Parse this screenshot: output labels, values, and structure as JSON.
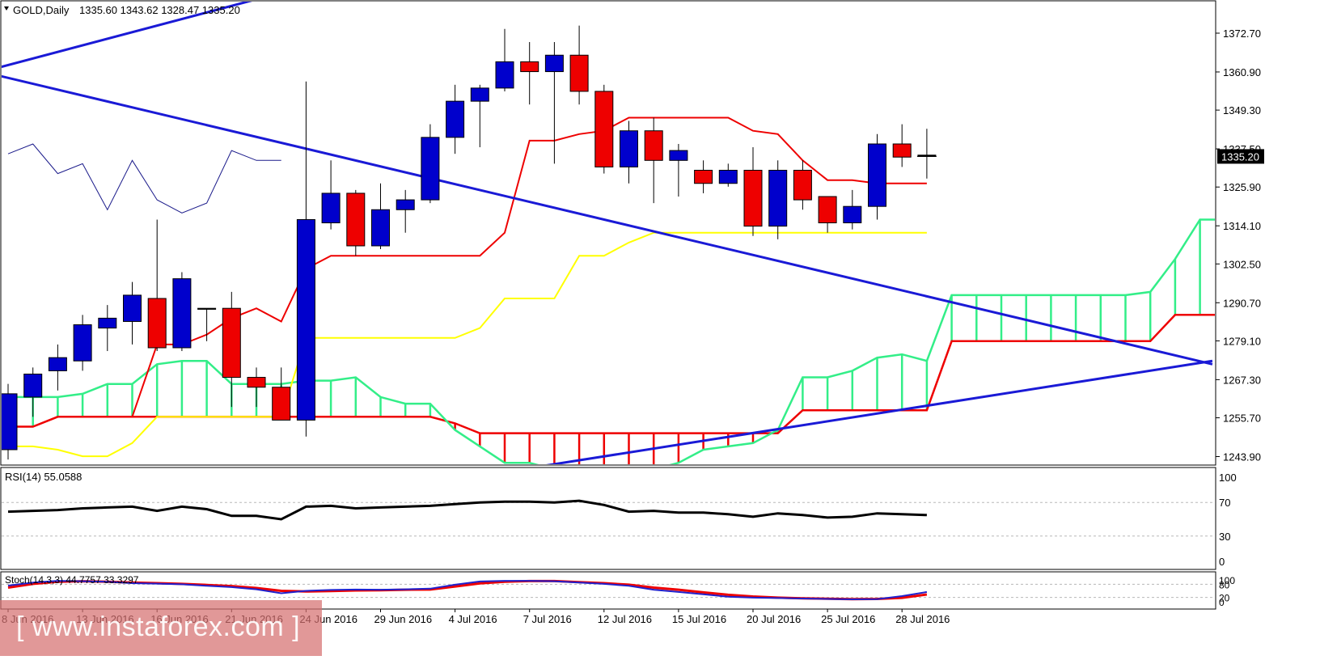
{
  "header": {
    "symbol": "GOLD,Daily",
    "ohlc": "1335.60 1343.62 1328.47 1335.20"
  },
  "watermark": {
    "text": "[ www.instaforex.com ]"
  },
  "colors": {
    "bull_candle": "#0000cc",
    "bear_candle": "#ee0000",
    "tenkan": "#ee0000",
    "kijun": "#ffff00",
    "senkou_a": "#33ee88",
    "senkou_b": "#ee0000",
    "trendline": "#1a1ad6",
    "chikou": "#1a1a8a",
    "rsi": "#000000",
    "stoch_main": "#2020cc",
    "stoch_signal": "#ee0000"
  },
  "chart_data": [
    {
      "type": "candlestick",
      "panel": "main",
      "title": "GOLD,Daily",
      "ylim": [
        1236,
        1385
      ],
      "y_ticks": [
        "1372.70",
        "1360.90",
        "1349.30",
        "1337.50",
        "1325.90",
        "1314.10",
        "1302.50",
        "1290.70",
        "1279.10",
        "1267.30",
        "1255.70",
        "1243.90"
      ],
      "current_price": "1335.20",
      "x_labels": [
        {
          "i": 0,
          "label": "8 Jun 2016"
        },
        {
          "i": 3,
          "label": "13 Jun 2016"
        },
        {
          "i": 6,
          "label": "16 Jun 2016"
        },
        {
          "i": 9,
          "label": "21 Jun 2016"
        },
        {
          "i": 12,
          "label": "24 Jun 2016"
        },
        {
          "i": 15,
          "label": "29 Jun 2016"
        },
        {
          "i": 18,
          "label": "4 Jul 2016"
        },
        {
          "i": 21,
          "label": "7 Jul 2016"
        },
        {
          "i": 24,
          "label": "12 Jul 2016"
        },
        {
          "i": 27,
          "label": "15 Jul 2016"
        },
        {
          "i": 30,
          "label": "20 Jul 2016"
        },
        {
          "i": 33,
          "label": "25 Jul 2016"
        },
        {
          "i": 36,
          "label": "28 Jul 2016"
        }
      ],
      "candles": [
        {
          "o": 1246,
          "h": 1266,
          "l": 1243,
          "c": 1263
        },
        {
          "o": 1262,
          "h": 1271,
          "l": 1256,
          "c": 1269
        },
        {
          "o": 1270,
          "h": 1278,
          "l": 1264,
          "c": 1274
        },
        {
          "o": 1273,
          "h": 1287,
          "l": 1270,
          "c": 1284
        },
        {
          "o": 1283,
          "h": 1290,
          "l": 1276,
          "c": 1286
        },
        {
          "o": 1285,
          "h": 1297,
          "l": 1278,
          "c": 1293
        },
        {
          "o": 1292,
          "h": 1316,
          "l": 1276,
          "c": 1277
        },
        {
          "o": 1277,
          "h": 1300,
          "l": 1276,
          "c": 1298
        },
        {
          "o": 1289,
          "h": 1289,
          "l": 1279,
          "c": 1289
        },
        {
          "o": 1289,
          "h": 1294,
          "l": 1259,
          "c": 1268
        },
        {
          "o": 1268,
          "h": 1271,
          "l": 1259,
          "c": 1265
        },
        {
          "o": 1265,
          "h": 1271,
          "l": 1255,
          "c": 1255
        },
        {
          "o": 1255,
          "h": 1358,
          "l": 1250,
          "c": 1316
        },
        {
          "o": 1315,
          "h": 1334,
          "l": 1313,
          "c": 1324
        },
        {
          "o": 1324,
          "h": 1325,
          "l": 1305,
          "c": 1308
        },
        {
          "o": 1308,
          "h": 1327,
          "l": 1307,
          "c": 1319
        },
        {
          "o": 1319,
          "h": 1325,
          "l": 1312,
          "c": 1322
        },
        {
          "o": 1322,
          "h": 1345,
          "l": 1321,
          "c": 1341
        },
        {
          "o": 1341,
          "h": 1357,
          "l": 1336,
          "c": 1352
        },
        {
          "o": 1352,
          "h": 1357,
          "l": 1338,
          "c": 1356
        },
        {
          "o": 1356,
          "h": 1374,
          "l": 1355,
          "c": 1364
        },
        {
          "o": 1364,
          "h": 1370,
          "l": 1351,
          "c": 1361
        },
        {
          "o": 1361,
          "h": 1370,
          "l": 1333,
          "c": 1366
        },
        {
          "o": 1366,
          "h": 1375,
          "l": 1351,
          "c": 1355
        },
        {
          "o": 1355,
          "h": 1357,
          "l": 1330,
          "c": 1332
        },
        {
          "o": 1332,
          "h": 1346,
          "l": 1327,
          "c": 1343
        },
        {
          "o": 1343,
          "h": 1347,
          "l": 1321,
          "c": 1334
        },
        {
          "o": 1334,
          "h": 1339,
          "l": 1323,
          "c": 1337
        },
        {
          "o": 1331,
          "h": 1334,
          "l": 1324,
          "c": 1327
        },
        {
          "o": 1327,
          "h": 1333,
          "l": 1326,
          "c": 1331
        },
        {
          "o": 1331,
          "h": 1338,
          "l": 1311,
          "c": 1314
        },
        {
          "o": 1314,
          "h": 1334,
          "l": 1310,
          "c": 1331
        },
        {
          "o": 1331,
          "h": 1334,
          "l": 1319,
          "c": 1322
        },
        {
          "o": 1323,
          "h": 1323,
          "l": 1312,
          "c": 1315
        },
        {
          "o": 1315,
          "h": 1325,
          "l": 1313,
          "c": 1320
        },
        {
          "o": 1320,
          "h": 1342,
          "l": 1316,
          "c": 1339
        },
        {
          "o": 1339,
          "h": 1345,
          "l": 1332,
          "c": 1335
        },
        {
          "o": 1335.6,
          "h": 1343.62,
          "l": 1328.47,
          "c": 1335.2
        }
      ],
      "tenkan": [
        1253,
        1253,
        1256,
        1256,
        1256,
        1256,
        1278,
        1278,
        1281,
        1286,
        1289,
        1285,
        1301,
        1305,
        1305,
        1305,
        1305,
        1305,
        1305,
        1305,
        1312,
        1340,
        1340,
        1342,
        1343,
        1347,
        1347,
        1347,
        1347,
        1347,
        1343,
        1342,
        1334,
        1328,
        1328,
        1327,
        1327,
        1327
      ],
      "kijun": [
        1247,
        1247,
        1246,
        1244,
        1244,
        1248,
        1256,
        1256,
        1256,
        1256,
        1256,
        1256,
        1280,
        1280,
        1280,
        1280,
        1280,
        1280,
        1280,
        1283,
        1292,
        1292,
        1292,
        1305,
        1305,
        1309,
        1312,
        1312,
        1312,
        1312,
        1312,
        1312,
        1312,
        1312,
        1312,
        1312,
        1312,
        1312
      ],
      "senkou_a": [
        1262,
        1262,
        1262,
        1263,
        1266,
        1266,
        1272,
        1273,
        1273,
        1266,
        1266,
        1266,
        1267,
        1267,
        1268,
        1262,
        1260,
        1260,
        1252,
        1247,
        1242,
        1242,
        1240,
        1240,
        1240,
        1240,
        1240,
        1242,
        1246,
        1247,
        1248,
        1252,
        1268,
        1268,
        1270,
        1274,
        1275,
        1273,
        1293,
        1293,
        1293,
        1293,
        1293,
        1293,
        1293,
        1293,
        1294,
        1304,
        1316,
        1316
      ],
      "senkou_b": [
        1253,
        1253,
        1256,
        1256,
        1256,
        1256,
        1256,
        1256,
        1256,
        1256,
        1256,
        1256,
        1256,
        1256,
        1256,
        1256,
        1256,
        1256,
        1254,
        1251,
        1251,
        1251,
        1251,
        1251,
        1251,
        1251,
        1251,
        1251,
        1251,
        1251,
        1251,
        1251,
        1258,
        1258,
        1258,
        1258,
        1258,
        1258,
        1279,
        1279,
        1279,
        1279,
        1279,
        1279,
        1279,
        1279,
        1279,
        1287,
        1287,
        1287
      ],
      "chikou": [
        1336,
        1339,
        1330,
        1333,
        1319,
        1334,
        1322,
        1318,
        1321,
        1337,
        1334,
        1334
      ],
      "trendlines": [
        {
          "from": {
            "i": -0.5,
            "y": 1360
          },
          "to": {
            "i": 48.5,
            "y": 1272
          }
        },
        {
          "from": {
            "i": 21.5,
            "y": 1241
          },
          "to": {
            "i": 48.5,
            "y": 1273
          }
        }
      ],
      "upper_channel": {
        "from": {
          "i": -0.5,
          "y": 1362
        },
        "to": {
          "i": 14.5,
          "y": 1392
        }
      }
    },
    {
      "type": "line",
      "panel": "rsi",
      "title": "RSI(14) 55.0588",
      "ylim": [
        0,
        100
      ],
      "y_ticks": [
        "100",
        "70",
        "30",
        "0"
      ],
      "levels": [
        70,
        30
      ],
      "values": [
        59,
        60,
        61,
        63,
        64,
        65,
        60,
        65,
        62,
        54,
        54,
        50,
        65,
        66,
        63,
        64,
        65,
        66,
        68,
        70,
        71,
        71,
        70,
        72,
        67,
        59,
        60,
        58,
        58,
        56,
        53,
        57,
        55,
        52,
        53,
        57,
        56,
        55
      ]
    },
    {
      "type": "line",
      "panel": "stoch",
      "title": "Stoch(14,3,3) 44.7757 33.3297",
      "ylim": [
        0,
        100
      ],
      "y_ticks": [
        "100",
        "80",
        "20",
        "0"
      ],
      "levels": [
        80,
        20
      ],
      "series": [
        {
          "values": [
            74,
            88,
            96,
            94,
            92,
            85,
            83,
            80,
            73,
            67,
            57,
            39,
            50,
            54,
            56,
            55,
            57,
            60,
            78,
            93,
            96,
            96,
            94,
            88,
            82,
            73,
            55,
            45,
            34,
            23,
            19,
            17,
            15,
            13,
            11,
            12,
            26,
            44.78
          ]
        },
        {
          "values": [
            65,
            82,
            92,
            94,
            92,
            88,
            85,
            82,
            77,
            72,
            63,
            50,
            47,
            49,
            52,
            53,
            55,
            56,
            70,
            84,
            92,
            95,
            95,
            90,
            85,
            78,
            65,
            55,
            43,
            32,
            24,
            19,
            16,
            14,
            12,
            13,
            18,
            33.33
          ]
        }
      ]
    }
  ]
}
